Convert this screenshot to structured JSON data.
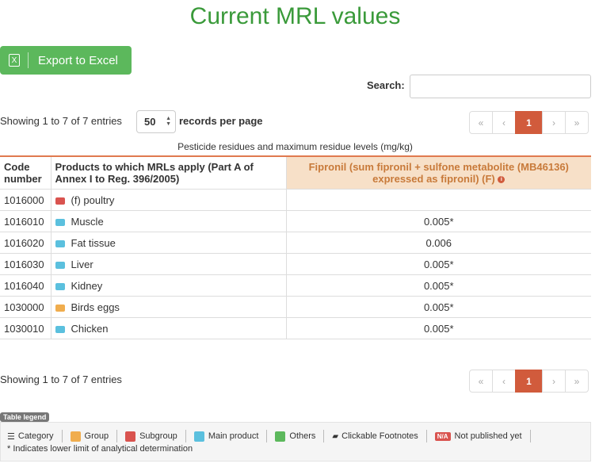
{
  "page": {
    "title": "Current MRL values"
  },
  "toolbar": {
    "export_label": "Export to Excel"
  },
  "search": {
    "label": "Search:",
    "value": "",
    "placeholder": ""
  },
  "length": {
    "info": "Showing 1 to 7 of 7 entries",
    "selected": "50",
    "label": "records per page"
  },
  "pagination": {
    "first": "«",
    "prev": "‹",
    "current": "1",
    "next": "›",
    "last": "»"
  },
  "table": {
    "caption": "Pesticide residues and maximum residue levels (mg/kg)",
    "headers": {
      "code": "Code number",
      "products": "Products to which MRLs apply (Part A of Annex I to Reg. 396/2005)",
      "substance": "Fipronil (sum fipronil + sulfone metabolite (MB46136) expressed as fipronil) (F)"
    },
    "rows": [
      {
        "code": "1016000",
        "product": "(f) poultry",
        "type": "Subgroup",
        "value": ""
      },
      {
        "code": "1016010",
        "product": "Muscle",
        "type": "Main product",
        "value": "0.005*"
      },
      {
        "code": "1016020",
        "product": "Fat tissue",
        "type": "Main product",
        "value": "0.006"
      },
      {
        "code": "1016030",
        "product": "Liver",
        "type": "Main product",
        "value": "0.005*"
      },
      {
        "code": "1016040",
        "product": "Kidney",
        "type": "Main product",
        "value": "0.005*"
      },
      {
        "code": "1030000",
        "product": "Birds eggs",
        "type": "Group",
        "value": "0.005*"
      },
      {
        "code": "1030010",
        "product": "Chicken",
        "type": "Main product",
        "value": "0.005*"
      }
    ]
  },
  "footer": {
    "info": "Showing 1 to 7 of 7 entries"
  },
  "legend": {
    "tag": "Table legend",
    "items": {
      "category": "Category",
      "group": "Group",
      "subgroup": "Subgroup",
      "main_product": "Main product",
      "others": "Others",
      "footnotes": "Clickable Footnotes",
      "na_badge": "N/A",
      "not_published": "Not published yet"
    },
    "note": "* Indicates lower limit of analytical determination"
  },
  "colors": {
    "group": "#f0ad4e",
    "subgroup": "#d9534f",
    "main_product": "#5bc0de",
    "others": "#5cb85c",
    "accent": "#d15b3c"
  }
}
